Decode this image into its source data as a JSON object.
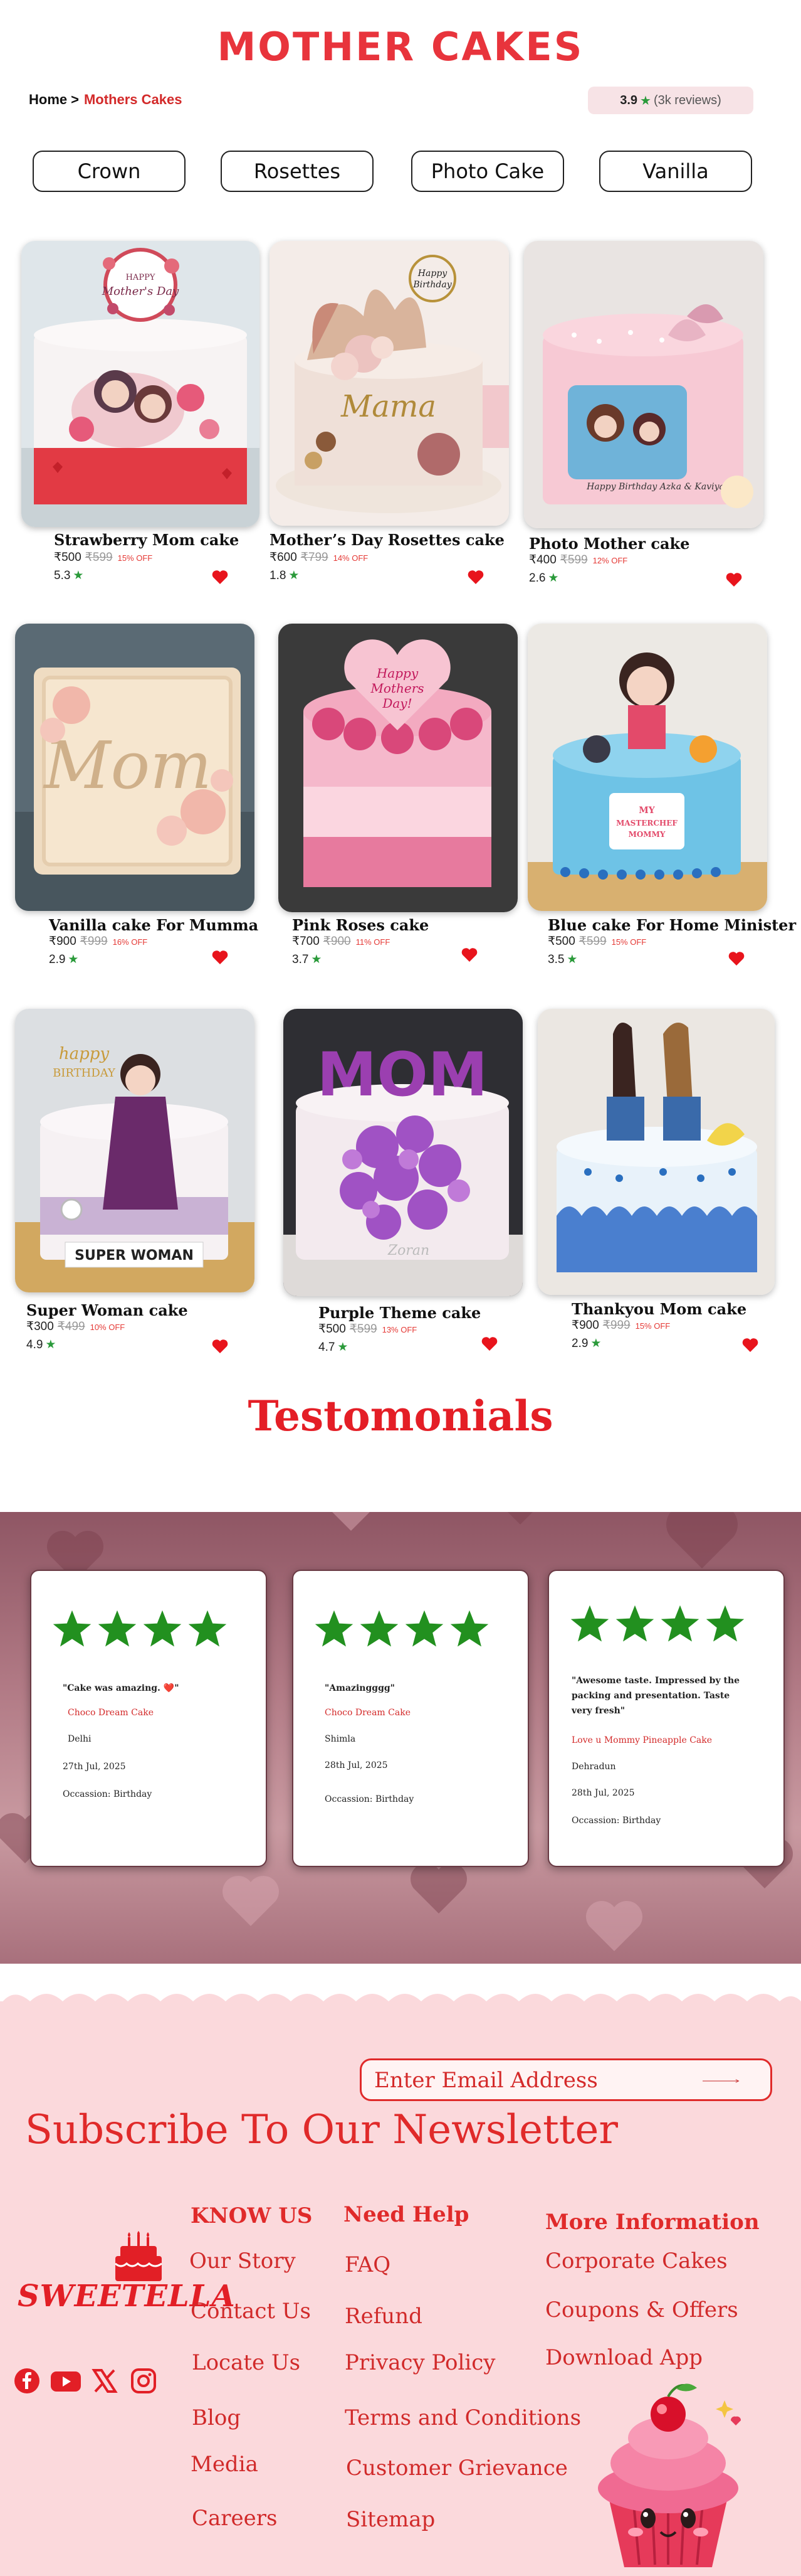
{
  "header": {
    "brand": "MOTHER CAKES",
    "breadcrumb": {
      "home": "Home",
      "separator": ">",
      "current": "Mothers Cakes"
    },
    "rating": {
      "value": "3.9",
      "reviews": "(3k reviews)"
    }
  },
  "tabs": [
    "Crown",
    "Rosettes",
    "Photo Cake",
    "Vanilla"
  ],
  "products": [
    {
      "name": "Strawberry Mom cake",
      "price": "₹500",
      "mrp": "₹599",
      "off": "15% OFF",
      "rating": "5.3"
    },
    {
      "name": "Mother’s Day Rosettes cake",
      "price": "₹600",
      "mrp": "₹799",
      "off": "14% OFF",
      "rating": "1.8"
    },
    {
      "name": "Photo Mother cake",
      "price": "₹400",
      "mrp": "₹599",
      "off": "12% OFF",
      "rating": "2.6"
    },
    {
      "name": "Vanilla cake For Mumma",
      "price": "₹900",
      "mrp": "₹999",
      "off": "16% OFF",
      "rating": "2.9"
    },
    {
      "name": "Pink Roses cake",
      "price": "₹700",
      "mrp": "₹900",
      "off": "11% OFF",
      "rating": "3.7"
    },
    {
      "name": "Blue cake For Home Minister",
      "price": "₹500",
      "mrp": "₹599",
      "off": "15% OFF",
      "rating": "3.5"
    },
    {
      "name": "Super Woman cake",
      "price": "₹300",
      "mrp": "₹499",
      "off": "10% OFF",
      "rating": "4.9"
    },
    {
      "name": "Purple Theme cake",
      "price": "₹500",
      "mrp": "₹599",
      "off": "13% OFF",
      "rating": "4.7"
    },
    {
      "name": "Thankyou Mom cake",
      "price": "₹900",
      "mrp": "₹999",
      "off": "15% OFF",
      "rating": "2.9"
    }
  ],
  "cake_texts": {
    "topper1": "HAPPY Mother's Day",
    "topper2": "Happy Birthday",
    "plaque2": "Mama",
    "sign3": "Happy Birthday Azka & Kaviya",
    "plaque4": "Mom",
    "heart5": "Happy Mothers Day!",
    "board6": "MY MASTERCHEF MOMMY",
    "topper7": "happy BIRTHDAY",
    "banner7": "SUPER WOMAN",
    "topper8": "MOM"
  },
  "testimonials": {
    "title": "Testomonials",
    "items": [
      {
        "quote": "\"Cake was amazing. ❤️\"",
        "flavour": "Choco Dream Cake",
        "city": "Delhi",
        "date": "27th Jul, 2025",
        "occasion": "Occassion: Birthday"
      },
      {
        "quote": "\"Amazingggg\"",
        "flavour": "Choco Dream Cake",
        "city": "Shimla",
        "date": "28th Jul, 2025",
        "occasion": "Occassion: Birthday"
      },
      {
        "quote": "\"Awesome taste. Impressed by the packing and presentation. Taste very fresh\"",
        "flavour": "Love u Mommy Pineapple Cake",
        "city": "Dehradun",
        "date": "28th Jul, 2025",
        "occasion": "Occassion: Birthday"
      }
    ]
  },
  "newsletter": {
    "placeholder": "Enter Email Address",
    "title": "Subscribe To Our Newsletter"
  },
  "footer": {
    "logo": "SWEETELLA",
    "know_us": {
      "heading": "KNOW US",
      "links": [
        "Our Story",
        "Contact Us",
        "Locate Us",
        "Blog",
        "Media",
        "Careers"
      ]
    },
    "need_help": {
      "heading": "Need Help",
      "links": [
        "FAQ",
        "Refund",
        "Privacy Policy",
        "Terms and Conditions",
        "Customer Grievance",
        "Sitemap"
      ]
    },
    "more_info": {
      "heading": "More Information",
      "links": [
        "Corporate Cakes",
        "Coupons  & Offers",
        "Download App"
      ]
    },
    "social": [
      "facebook-icon",
      "youtube-icon",
      "x-icon",
      "instagram-icon"
    ]
  },
  "colors": {
    "brand_red": "#e8343c",
    "accent_green": "#2a9a3a",
    "footer_bg": "#fbd9dc"
  }
}
